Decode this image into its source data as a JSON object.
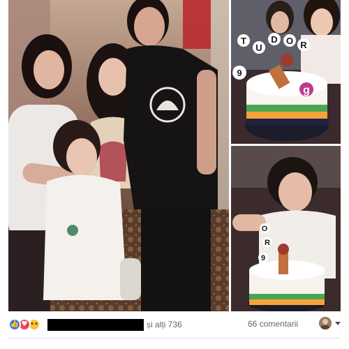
{
  "post": {
    "reactions": {
      "icons": [
        "like-icon",
        "love-icon",
        "wow-icon"
      ],
      "others_text": "și alți 736",
      "comments_text": "66 comentarii"
    }
  },
  "colors": {
    "like": "#3b7bf0",
    "love": "#f0445a",
    "wow": "#f7c531",
    "secondary_text": "#616770"
  },
  "photos": {
    "cake_text_letters": [
      "T",
      "U",
      "D",
      "O",
      "R"
    ],
    "cake_number": "9",
    "cake_number_small": "g"
  }
}
